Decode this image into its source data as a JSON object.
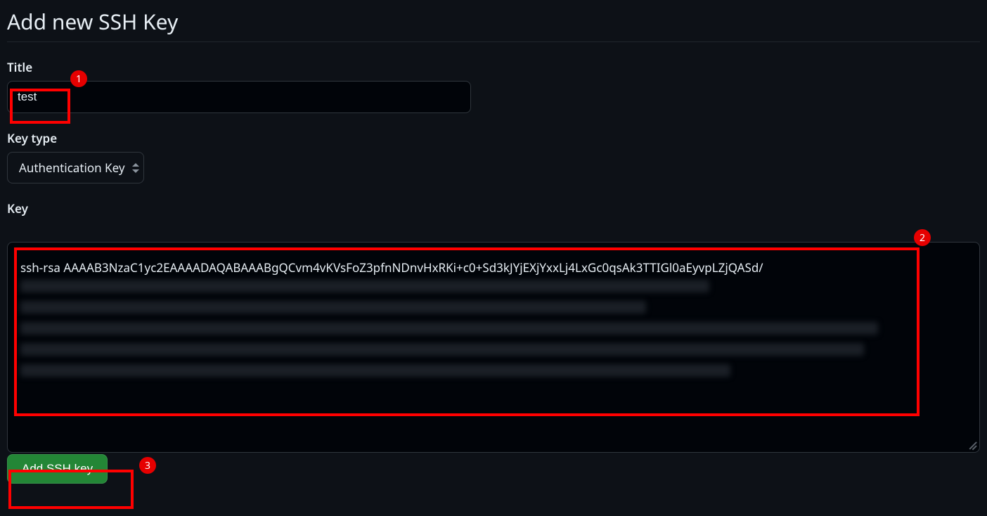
{
  "page": {
    "heading": "Add new SSH Key"
  },
  "form": {
    "title": {
      "label": "Title",
      "value": "test"
    },
    "key_type": {
      "label": "Key type",
      "selected": "Authentication Key"
    },
    "key": {
      "label": "Key",
      "value": "ssh-rsa AAAAB3NzaC1yc2EAAAADAQABAAABgQCvm4vKVsFoZ3pfnNDnvHxRKi+c0+Sd3kJYjEXjYxxLj4LxGc0qsAk3TTIGl0aEyvpLZjQASd/"
    },
    "submit_label": "Add SSH key"
  },
  "annotations": {
    "1": "1",
    "2": "2",
    "3": "3"
  }
}
